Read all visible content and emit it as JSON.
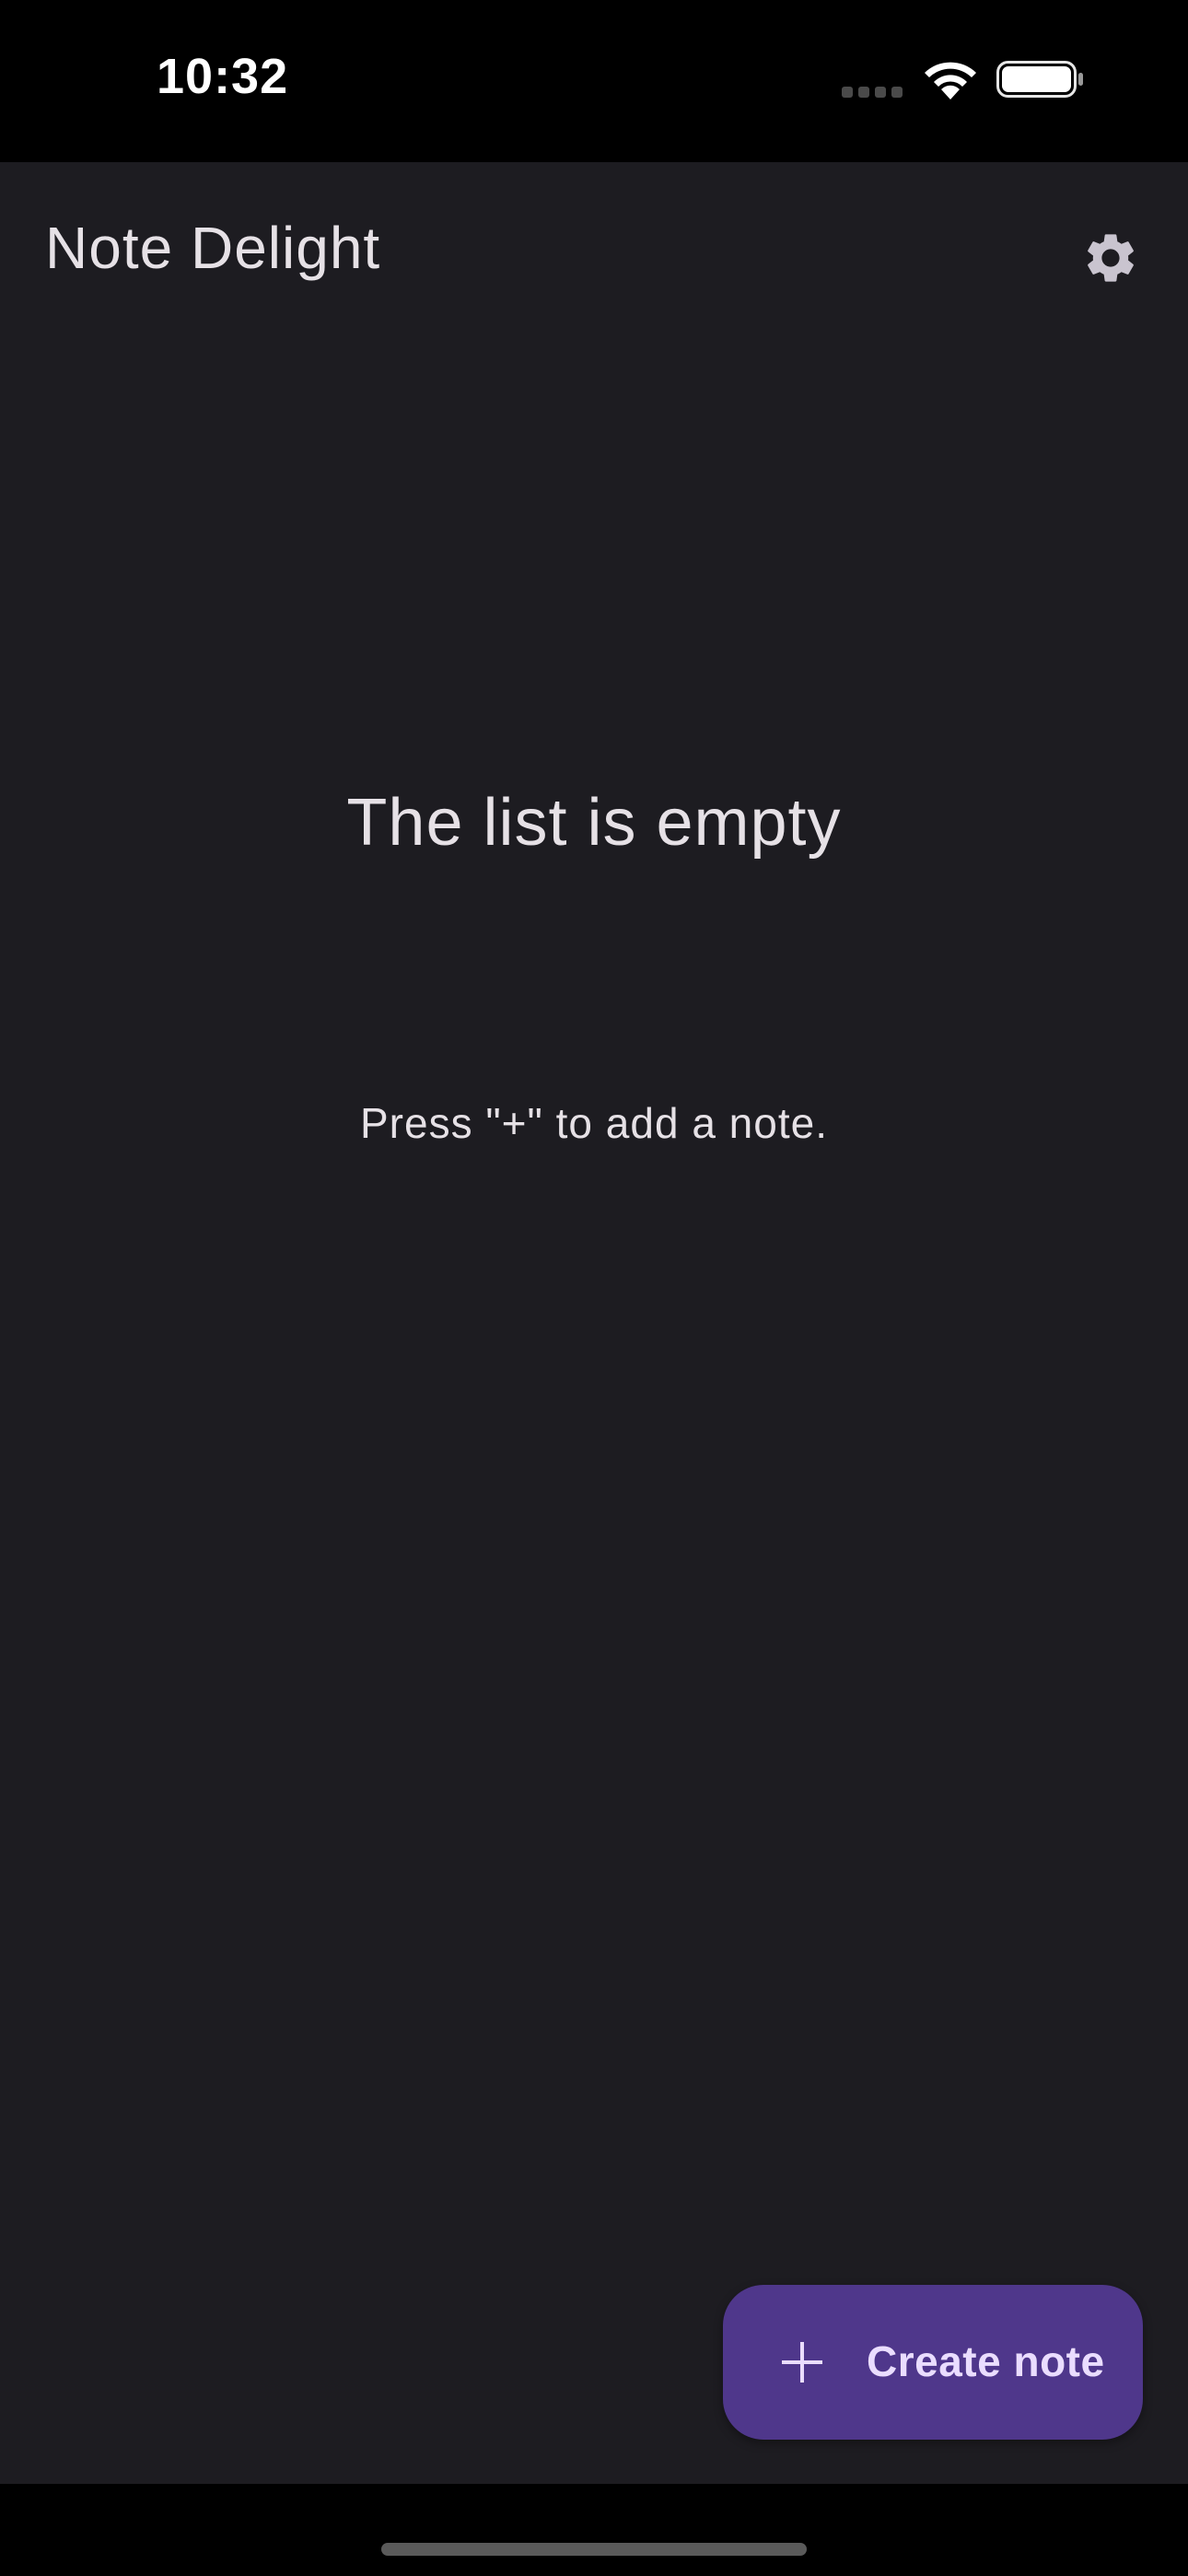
{
  "status_bar": {
    "time": "10:32",
    "icons": [
      "cellular-signal-icon",
      "wifi-icon",
      "battery-icon"
    ]
  },
  "app_bar": {
    "title": "Note Delight",
    "settings_icon": "gear-icon"
  },
  "empty_state": {
    "title": "The list is empty",
    "hint": "Press \"+\" to add a note."
  },
  "fab": {
    "icon": "plus-icon",
    "label": "Create note"
  },
  "colors": {
    "background": "#1d1c21",
    "status_bar": "#000000",
    "fab_background": "#4f378b",
    "fab_text": "#eaddff",
    "text_primary": "#e6e1e6"
  }
}
